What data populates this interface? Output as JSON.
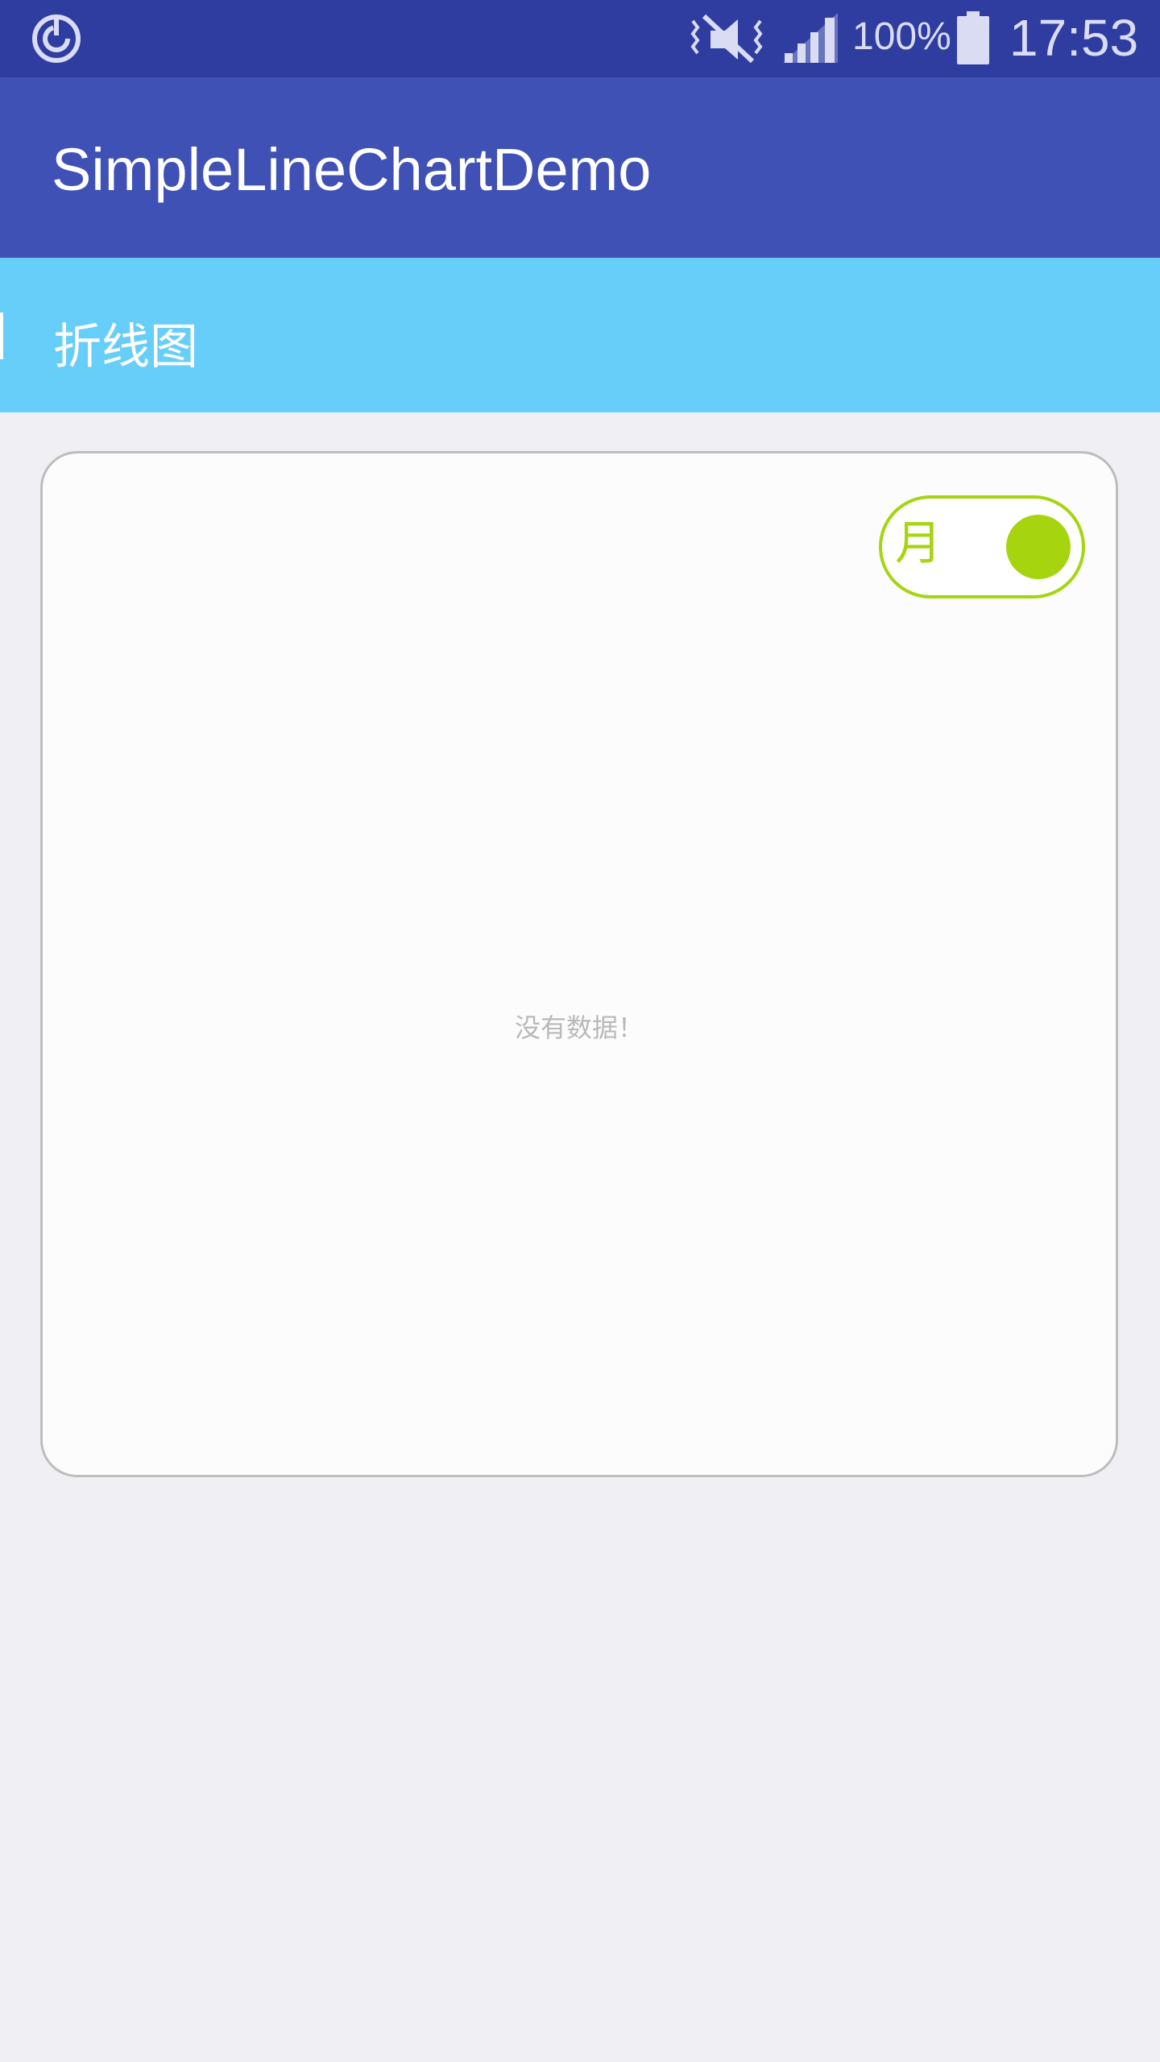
{
  "status_bar": {
    "battery_percent": "100%",
    "time": "17:53",
    "icons": [
      "sync-icon",
      "vibrate-mute-icon",
      "signal-icon",
      "battery-icon"
    ]
  },
  "app_bar": {
    "title": "SimpleLineChartDemo"
  },
  "section": {
    "title": "折线图"
  },
  "chart_card": {
    "toggle_label": "月",
    "toggle_state": "on",
    "empty_text": "没有数据！"
  },
  "colors": {
    "status_bar": "#2f3da0",
    "app_bar": "#3f51b5",
    "section_bar": "#67cdf9",
    "toggle_accent": "#a6d50f",
    "background": "#efeff4"
  }
}
